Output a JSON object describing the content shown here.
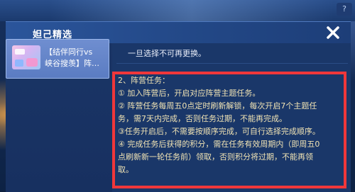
{
  "modal": {
    "title": "妲己精选",
    "close_icon": "close-icon"
  },
  "top_badge": "?",
  "sidebar": {
    "card": {
      "label_line1": "【结伴同行vs",
      "label_line2": "峡谷搜羡】阵…"
    }
  },
  "content": {
    "top_note": "一旦选择不可再更换。",
    "rules": [
      "2、阵营任务：",
      "① 加入阵营后，开启对应阵营主题任务。",
      "② 阵营任务每周五0点定时刷新解锁，每次开启7个主题任",
      "务，需7天内完成，否则任务过期，不能再完成。",
      "③任务开启后，不需要按顺序完成，可自行选择完成顺序。",
      "④ 完成任务后获得的积分，需在任务有效周期内（即周五0",
      "点刷新新一轮任务前）领取，否则积分将过期，不能再领",
      "取。"
    ]
  },
  "colors": {
    "highlight_border": "#f0373a",
    "rule_text": "#f0e3b4"
  }
}
